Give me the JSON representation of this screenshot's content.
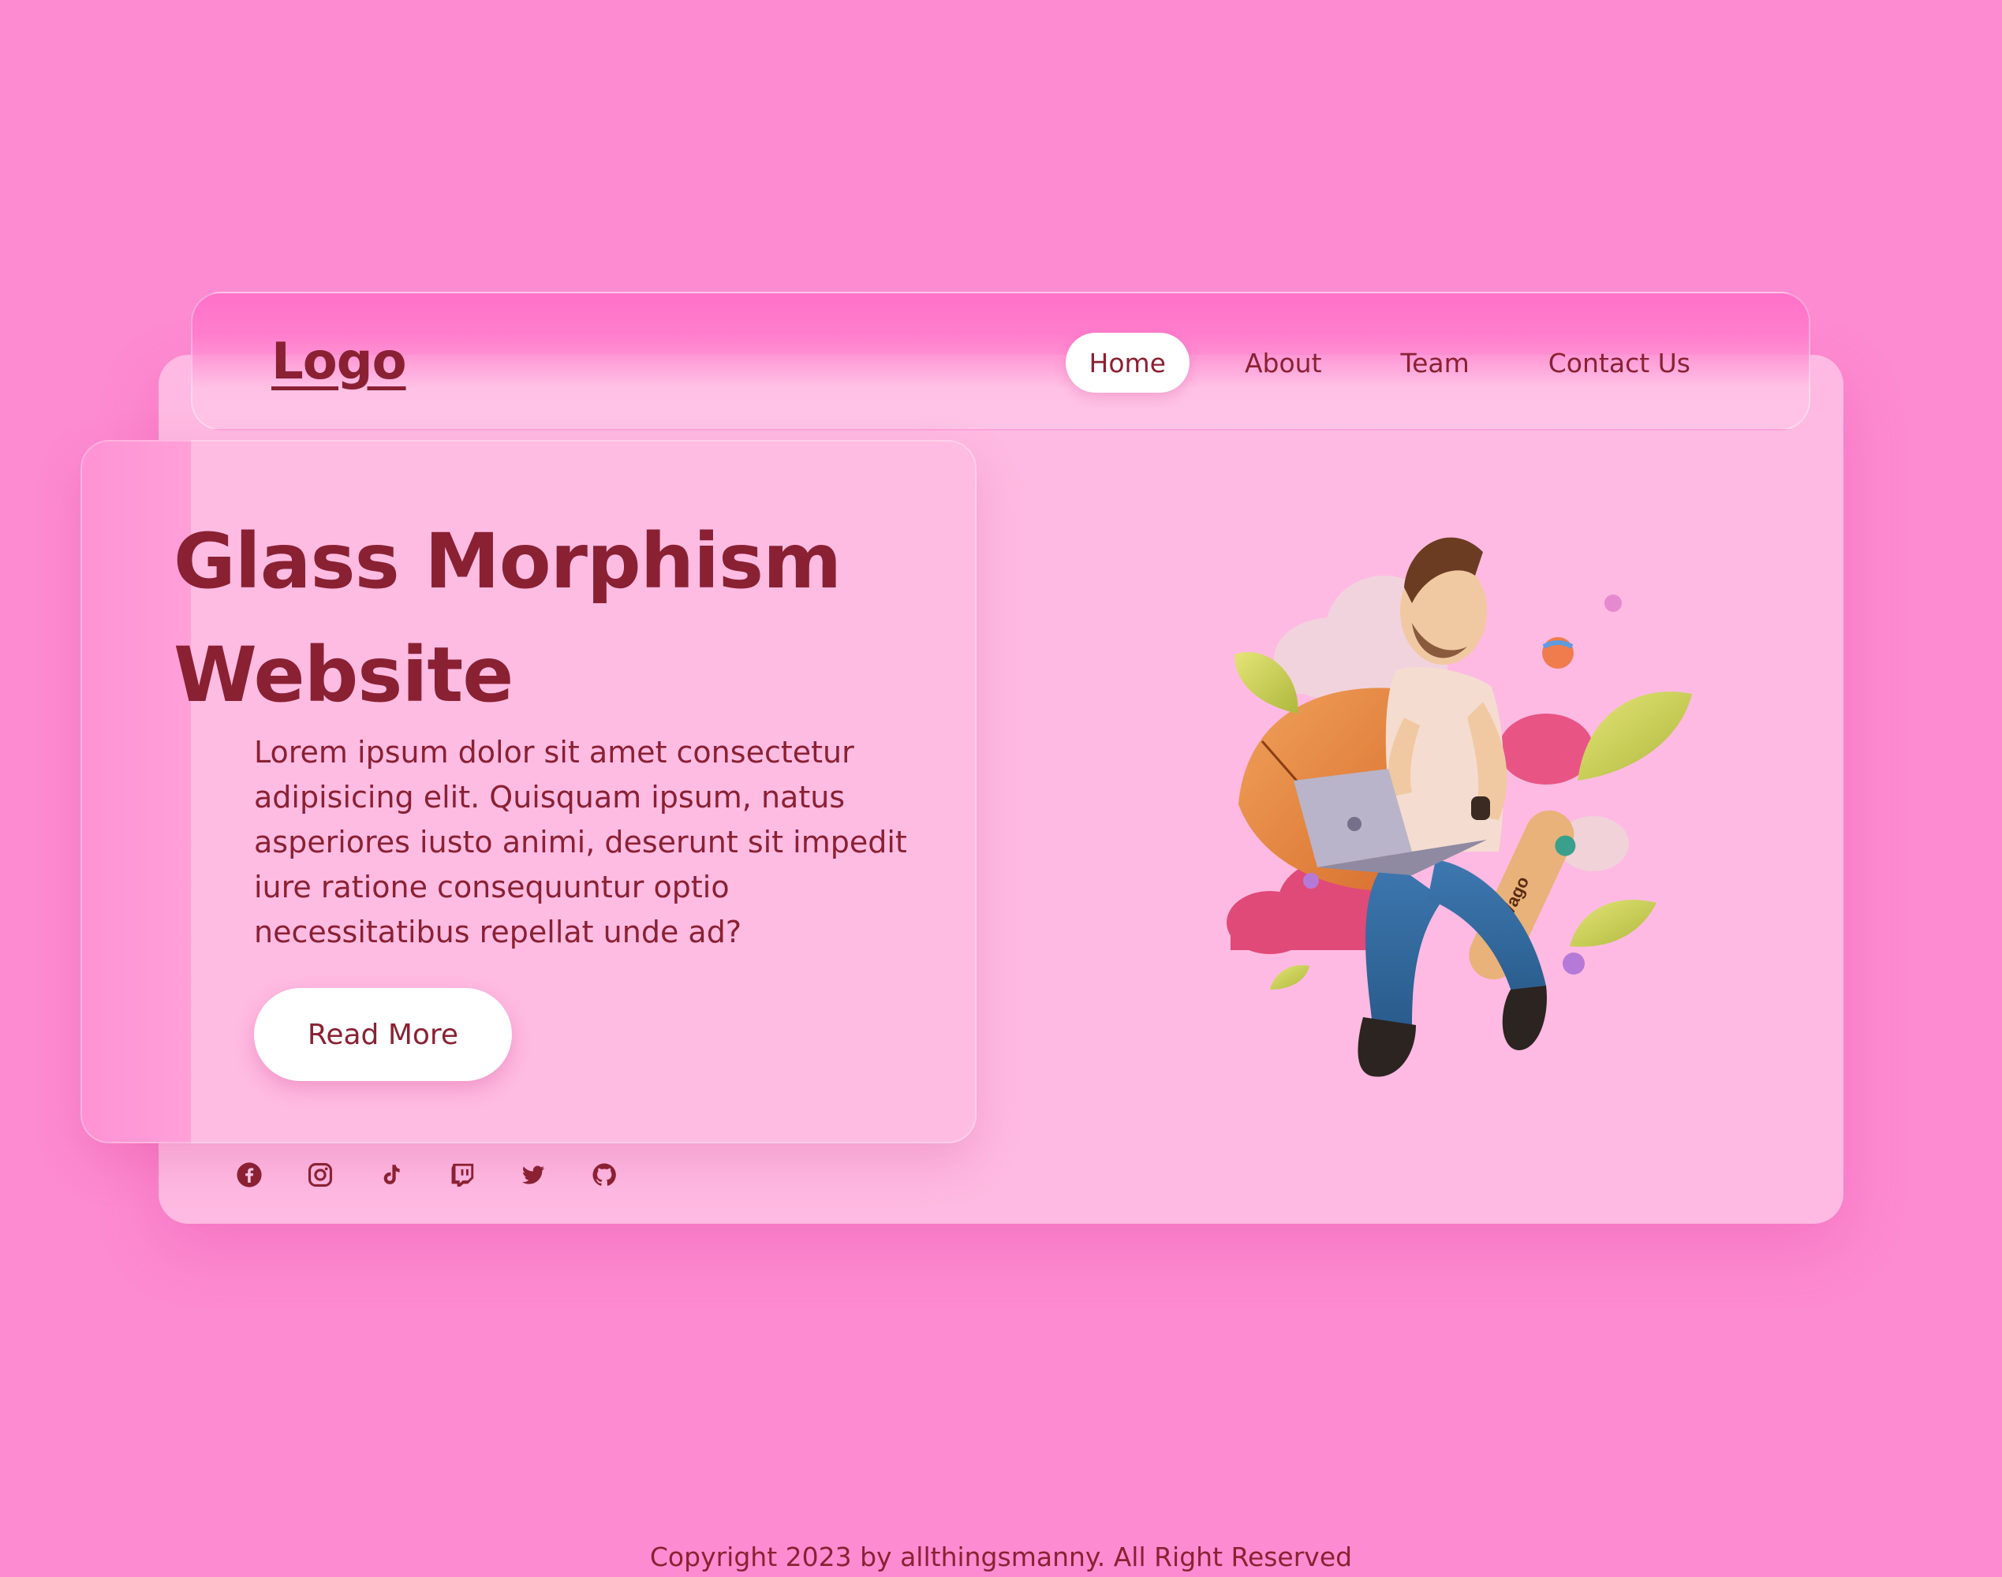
{
  "nav": {
    "logo": "Logo",
    "links": [
      {
        "label": "Home",
        "active": true
      },
      {
        "label": "About",
        "active": false
      },
      {
        "label": "Team",
        "active": false
      },
      {
        "label": "Contact Us",
        "active": false
      }
    ]
  },
  "hero": {
    "title": "Glass Morphism Website",
    "description": "Lorem ipsum dolor sit amet consectetur adipisicing elit. Quisquam ipsum, natus asperiores iusto animi, deserunt sit impedit iure ratione consequuntur optio necessitatibus repellat unde ad?",
    "button_label": "Read More"
  },
  "illustration": {
    "skateboard_text": "Vago"
  },
  "socials": [
    {
      "icon": "facebook-icon"
    },
    {
      "icon": "instagram-icon"
    },
    {
      "icon": "tiktok-icon"
    },
    {
      "icon": "twitch-icon"
    },
    {
      "icon": "twitter-icon"
    },
    {
      "icon": "github-icon"
    }
  ],
  "footer": {
    "copyright": "Copyright 2023 by allthingsmanny. All Right Reserved"
  },
  "colors": {
    "background": "#fd8bd1",
    "accent": "#ff5ec0",
    "text": "#8a2133",
    "button": "#ffffff"
  }
}
